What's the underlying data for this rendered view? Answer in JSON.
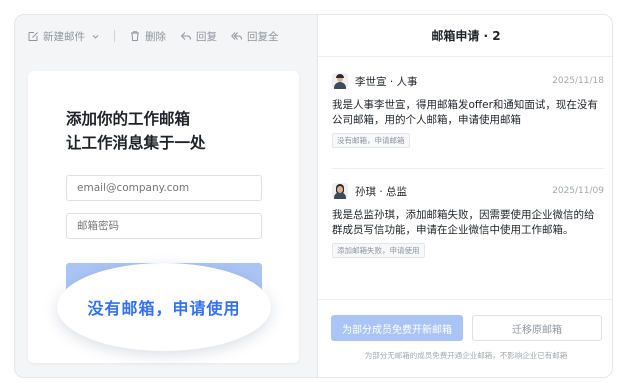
{
  "toolbar": {
    "new_mail": "新建邮件",
    "delete": "删除",
    "reply": "回复",
    "reply_all": "回复全"
  },
  "promo": {
    "title": "添加你的工作邮箱\n让工作消息集于一处",
    "email_placeholder": "email@company.com",
    "password_placeholder": "邮箱密码",
    "callout": "没有邮箱，申请使用"
  },
  "panel": {
    "title": "邮箱申请 · 2"
  },
  "requests": [
    {
      "name": "李世宣 · 人事",
      "date": "2025/11/18",
      "message": "我是人事李世宣，得用邮箱发offer和通知面试，现在没有公司邮箱，用的个人邮箱，申请使用邮箱",
      "tag": "没有邮箱，申请邮箱"
    },
    {
      "name": "孙琪 · 总监",
      "date": "2025/11/09",
      "message": "我是总监孙琪，添加邮箱失败，因需要使用企业微信的给群成员写信功能，申请在企业微信中使用工作邮箱。",
      "tag": "添加邮箱失败，申请使用"
    }
  ],
  "footer": {
    "primary_button": "为部分成员免费开新邮箱",
    "secondary_button": "迁移原邮箱",
    "note": "为部分无邮箱的成员免费开通企业邮箱，不影响企业已有邮箱"
  },
  "colors": {
    "accent": "#3370ff",
    "primary_disabled": "#a9c4f5"
  }
}
